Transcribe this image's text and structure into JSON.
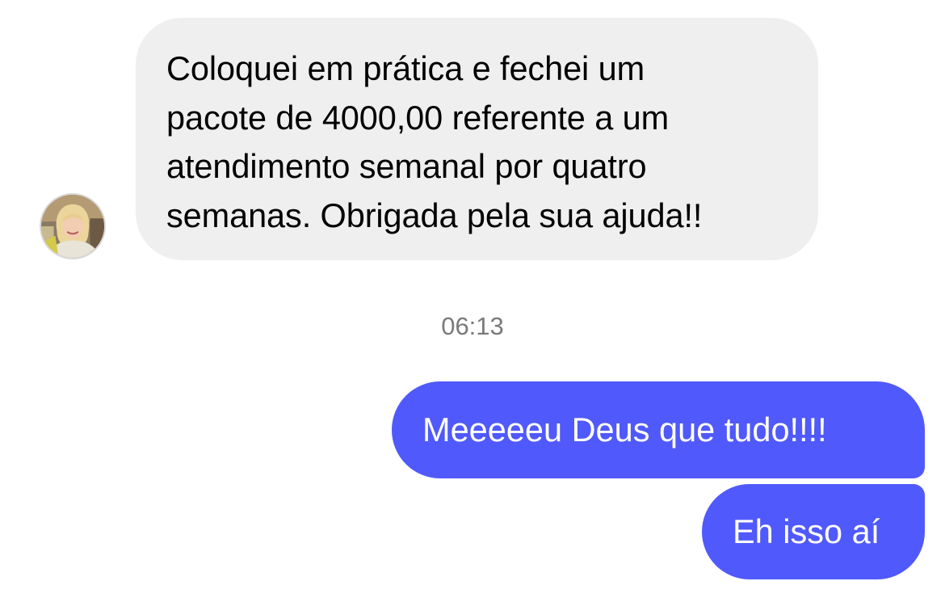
{
  "conversation": {
    "incoming": {
      "text": "Coloquei em prática e fechei um\npacote de 4000,00 referente a um\natendimento semanal por quatro\nsemanas. Obrigada pela sua ajuda!!",
      "avatar_icon": "user-avatar-photo"
    },
    "timestamp": "06:13",
    "outgoing": [
      {
        "text": "Meeeeeu Deus que tudo!!!!"
      },
      {
        "text": "Eh isso aí"
      }
    ]
  },
  "colors": {
    "incoming_bubble": "#efefef",
    "outgoing_bubble": "#5059fb",
    "timestamp_text": "#7a7a7a"
  }
}
